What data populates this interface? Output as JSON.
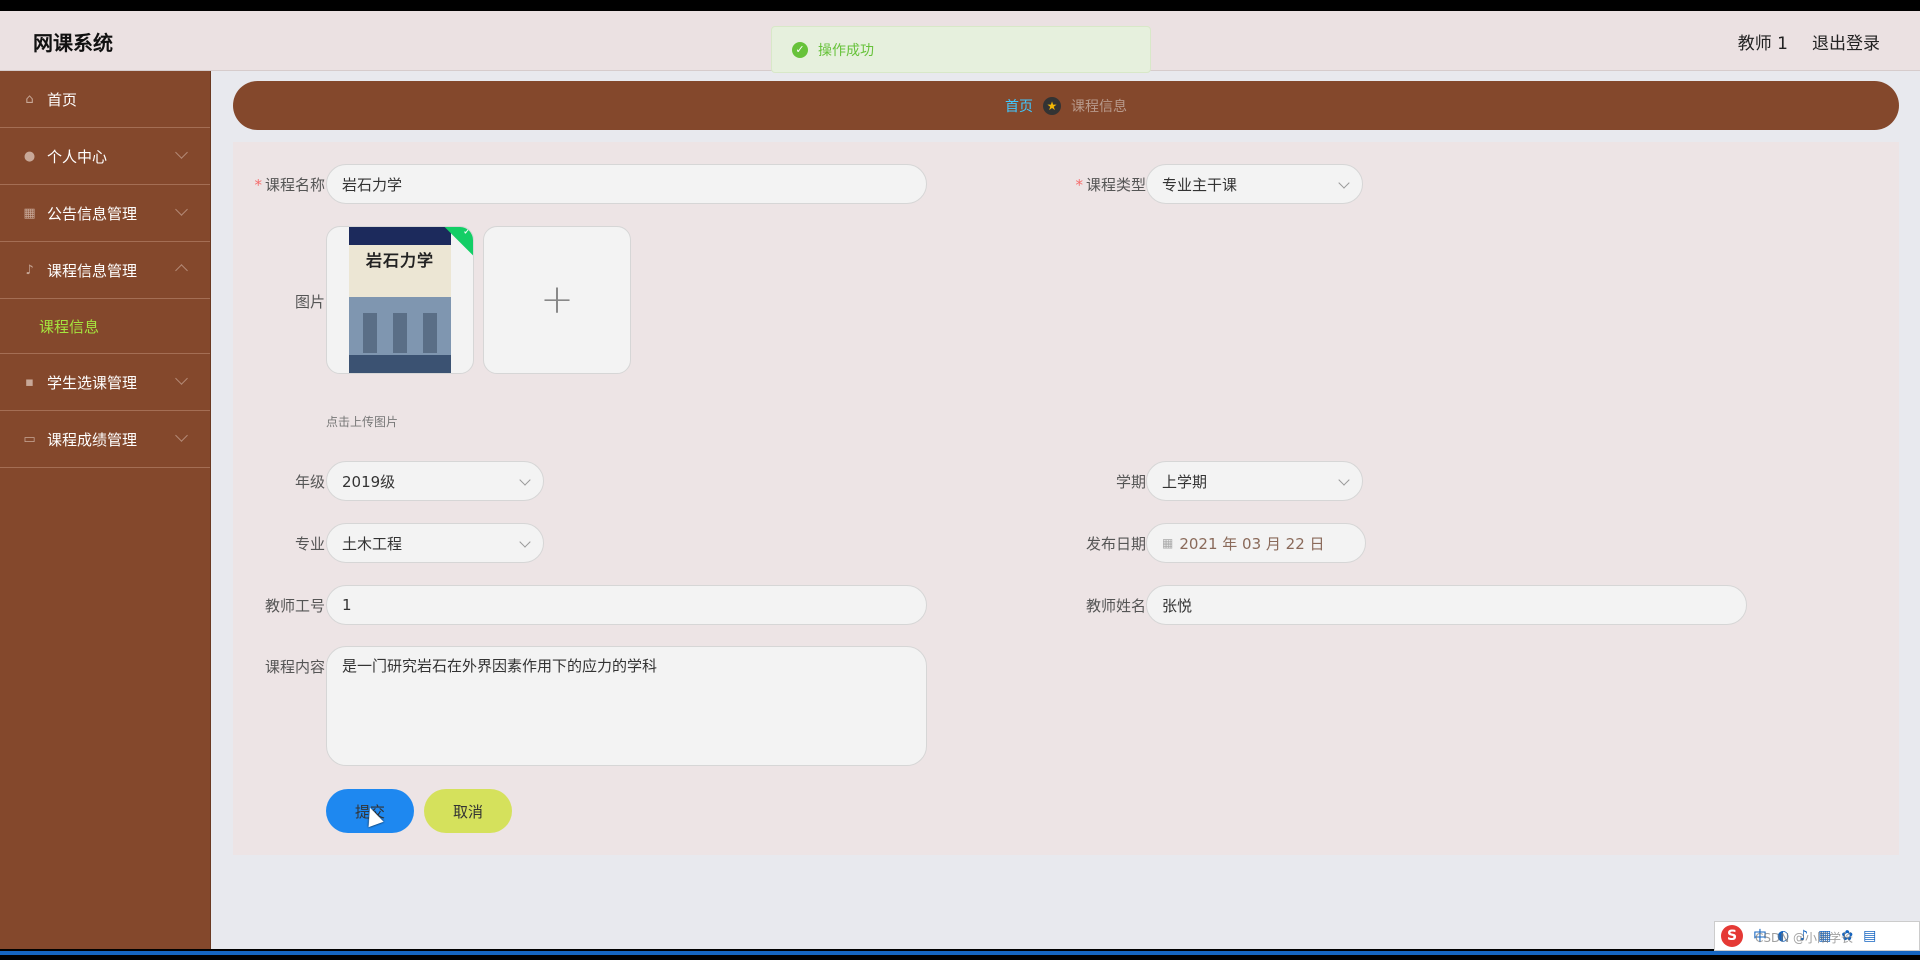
{
  "app": {
    "title": "网课系统"
  },
  "topbar": {
    "user": "教师 1",
    "logout": "退出登录"
  },
  "toast": {
    "message": "操作成功"
  },
  "sidebar": {
    "items": [
      {
        "label": "首页",
        "icon": "home-icon"
      },
      {
        "label": "个人中心",
        "icon": "user-icon"
      },
      {
        "label": "公告信息管理",
        "icon": "chart-icon"
      },
      {
        "label": "课程信息管理",
        "icon": "microphone-icon"
      },
      {
        "label": "学生选课管理",
        "icon": "grid-icon"
      },
      {
        "label": "课程成绩管理",
        "icon": "monitor-icon"
      }
    ],
    "submenu": {
      "label": "课程信息"
    }
  },
  "breadcrumb": {
    "home": "首页",
    "current": "课程信息"
  },
  "form": {
    "course_name": {
      "label": "课程名称",
      "value": "岩石力学"
    },
    "course_type": {
      "label": "课程类型",
      "value": "专业主干课"
    },
    "image": {
      "label": "图片",
      "book_title": "岩石力学",
      "hint": "点击上传图片"
    },
    "grade": {
      "label": "年级",
      "value": "2019级"
    },
    "semester": {
      "label": "学期",
      "value": "上学期"
    },
    "major": {
      "label": "专业",
      "value": "土木工程"
    },
    "publish_date": {
      "label": "发布日期",
      "value": "2021 年 03 月 22 日"
    },
    "teacher_id": {
      "label": "教师工号",
      "value": "1"
    },
    "teacher_name": {
      "label": "教师姓名",
      "value": "张悦"
    },
    "content": {
      "label": "课程内容",
      "value": "是一门研究岩石在外界因素作用下的应力的学科"
    },
    "submit": "提交",
    "cancel": "取消"
  },
  "taskbar": {
    "ime_char": "中",
    "watermark": "CSDN @小阳学长"
  },
  "colors": {
    "sidebar": "#84482c",
    "accent": "#40c8ff",
    "submit": "#1e88f0",
    "cancel": "#d5e15c",
    "success": "#67c23a"
  }
}
